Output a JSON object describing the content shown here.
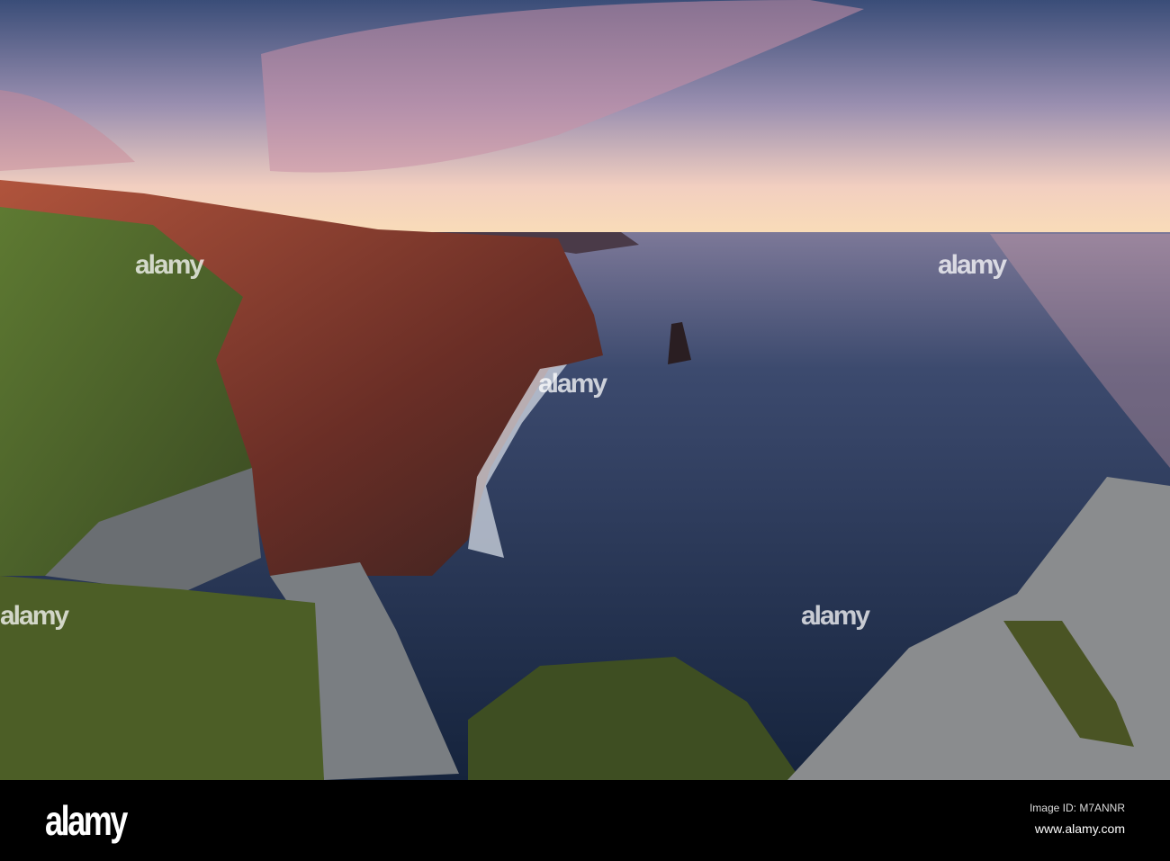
{
  "photo": {
    "subject": "sea cliffs at sunset",
    "watermark_text": "alamy"
  },
  "footer": {
    "logo": "alamy",
    "image_id": "Image ID: M7ANNR",
    "url": "www.alamy.com"
  },
  "colors": {
    "sky_top": "#3c4f7a",
    "sky_horizon": "#f7d6b2",
    "sea": "#1f3050",
    "cliff": "#8a3a2a",
    "grass": "#4f6a2a"
  }
}
